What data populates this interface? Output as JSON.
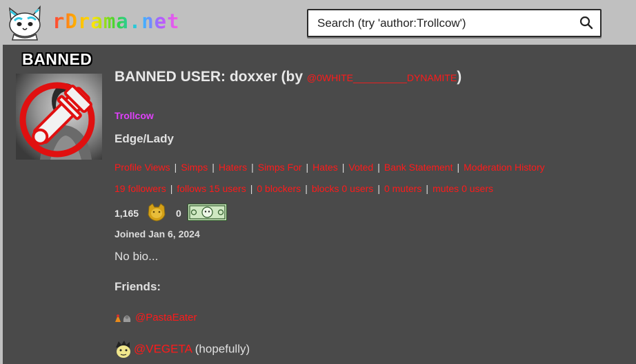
{
  "header": {
    "site_name": "rDrama.net",
    "logo_icon": "cat-logo-icon",
    "search": {
      "placeholder": "Search (try 'author:Trollcow')",
      "icon": "search-icon"
    }
  },
  "profile": {
    "banned_label": "BANNED",
    "title_prefix": "BANNED USER: doxxer (by ",
    "banned_by": "@0WHITE__________DYNAMITE",
    "title_suffix": ")",
    "badge_name": "Trollcow",
    "custom_title": "Edge/Lady",
    "links": [
      "Profile Views",
      "Simps",
      "Haters",
      "Simps For",
      "Hates",
      "Voted",
      "Bank Statement",
      "Moderation History"
    ],
    "follow_links": [
      "19 followers",
      "follows 15 users",
      "0 blockers",
      "blocks 0 users",
      "0 muters",
      "mutes 0 users"
    ],
    "separator": "|",
    "coins": "1,165",
    "marseybux": "0",
    "joined": "Joined Jan 6, 2024",
    "bio": "No bio...",
    "friends_label": "Friends:",
    "friends": [
      {
        "name": "@PastaEater",
        "note": ""
      },
      {
        "name": "@VEGETA",
        "note": "(hopefully)"
      }
    ]
  },
  "colors": {
    "link_red": "#ff1a1a",
    "badge_purple": "#e040fb",
    "panel_bg": "#4a4a4a",
    "header_bg": "#c0c0c0"
  }
}
